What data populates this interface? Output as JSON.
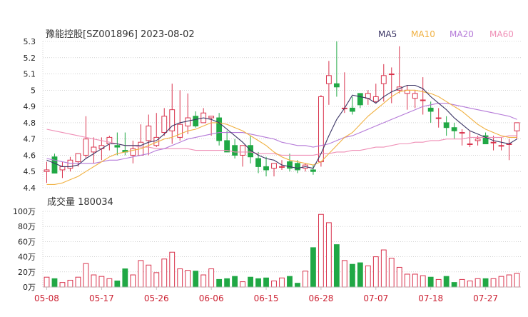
{
  "header": {
    "title": "豫能控股[SZ001896] 2023-08-02",
    "ma5_label": "MA5",
    "ma10_label": "MA10",
    "ma20_label": "MA20",
    "ma60_label": "MA60"
  },
  "colors": {
    "up": "#d9334d",
    "down": "#20a845",
    "ma5": "#3b3565",
    "ma10": "#f0b040",
    "ma20": "#b57ad8",
    "ma60": "#ef8fb6",
    "grid": "#b9b9b9",
    "axis_text": "#222222",
    "date_text": "#cc2233"
  },
  "volume_panel": {
    "title": "成交量 180034"
  },
  "chart_data": [
    {
      "type": "candlestick",
      "title": "豫能控股[SZ001896] 2023-08-02",
      "ylim": [
        4.4,
        5.3
      ],
      "yticks": [
        "5.3",
        "5.2",
        "5.1",
        "5",
        "4.9",
        "4.8",
        "4.7",
        "4.6",
        "4.5",
        "4.4"
      ],
      "x": [
        "05-08",
        "05-09",
        "05-10",
        "05-11",
        "05-12",
        "05-15",
        "05-16",
        "05-17",
        "05-18",
        "05-19",
        "05-22",
        "05-23",
        "05-24",
        "05-25",
        "05-26",
        "05-29",
        "05-30",
        "05-31",
        "06-01",
        "06-02",
        "06-05",
        "06-06",
        "06-07",
        "06-08",
        "06-09",
        "06-12",
        "06-13",
        "06-14",
        "06-15",
        "06-16",
        "06-19",
        "06-20",
        "06-21",
        "06-26",
        "06-27",
        "06-28",
        "06-29",
        "06-30",
        "07-03",
        "07-04",
        "07-05",
        "07-06",
        "07-07",
        "07-10",
        "07-11",
        "07-12",
        "07-13",
        "07-14",
        "07-17",
        "07-18",
        "07-19",
        "07-20",
        "07-21",
        "07-24",
        "07-25",
        "07-26",
        "07-27",
        "07-28",
        "07-31",
        "08-01",
        "08-02"
      ],
      "x_tick_labels": [
        "05-08",
        "05-17",
        "05-26",
        "06-06",
        "06-15",
        "06-28",
        "07-07",
        "07-18",
        "07-27"
      ],
      "open": [
        4.5,
        4.59,
        4.51,
        4.52,
        4.56,
        4.6,
        4.62,
        4.64,
        4.67,
        4.66,
        4.63,
        4.6,
        4.6,
        4.69,
        4.66,
        4.74,
        4.75,
        4.71,
        4.78,
        4.84,
        4.8,
        4.83,
        4.83,
        4.69,
        4.66,
        4.6,
        4.66,
        4.58,
        4.53,
        4.52,
        4.53,
        4.56,
        4.55,
        4.52,
        4.51,
        4.56,
        5.04,
        5.04,
        4.89,
        4.89,
        4.98,
        4.95,
        4.93,
        5.04,
        5.1,
        5.0,
        4.98,
        4.95,
        4.94,
        4.89,
        4.83,
        4.8,
        4.77,
        4.74,
        4.67,
        4.69,
        4.72,
        4.68,
        4.66,
        4.67,
        4.75
      ],
      "high": [
        4.56,
        4.61,
        4.56,
        4.59,
        4.61,
        4.84,
        4.71,
        4.71,
        4.72,
        4.74,
        4.74,
        4.69,
        4.79,
        4.85,
        4.86,
        4.89,
        5.04,
        5.0,
        4.98,
        4.87,
        4.89,
        4.84,
        4.86,
        4.75,
        4.7,
        4.66,
        4.72,
        4.62,
        4.59,
        4.55,
        4.57,
        4.61,
        4.57,
        4.55,
        4.54,
        4.97,
        5.18,
        5.3,
        5.11,
        4.96,
        4.97,
        5.0,
        5.04,
        5.16,
        5.14,
        5.27,
        5.03,
        5.0,
        5.08,
        4.93,
        4.89,
        4.84,
        4.8,
        4.76,
        4.75,
        4.72,
        4.74,
        4.72,
        4.71,
        4.7,
        4.8
      ],
      "low": [
        4.43,
        4.51,
        4.46,
        4.5,
        4.53,
        4.58,
        4.55,
        4.57,
        4.63,
        4.6,
        4.6,
        4.55,
        4.6,
        4.6,
        4.65,
        4.72,
        4.67,
        4.69,
        4.73,
        4.77,
        4.8,
        4.72,
        4.66,
        4.62,
        4.58,
        4.53,
        4.55,
        4.49,
        4.47,
        4.47,
        4.51,
        4.5,
        4.49,
        4.5,
        4.48,
        4.53,
        4.91,
        4.96,
        4.86,
        4.85,
        4.89,
        4.91,
        4.92,
        4.93,
        4.92,
        4.98,
        4.88,
        4.89,
        4.85,
        4.8,
        4.77,
        4.72,
        4.7,
        4.66,
        4.65,
        4.66,
        4.67,
        4.63,
        4.63,
        4.57,
        4.7
      ],
      "close": [
        4.51,
        4.49,
        4.53,
        4.57,
        4.61,
        4.7,
        4.65,
        4.66,
        4.71,
        4.65,
        4.62,
        4.64,
        4.68,
        4.78,
        4.71,
        4.84,
        4.88,
        4.79,
        4.83,
        4.78,
        4.86,
        4.84,
        4.69,
        4.62,
        4.6,
        4.66,
        4.59,
        4.53,
        4.51,
        4.55,
        4.53,
        4.52,
        4.51,
        4.54,
        4.5,
        4.96,
        5.09,
        5.02,
        4.89,
        4.87,
        4.91,
        4.98,
        4.96,
        5.09,
        5.1,
        5.02,
        5.0,
        4.98,
        4.94,
        4.87,
        4.83,
        4.77,
        4.75,
        4.74,
        4.67,
        4.7,
        4.67,
        4.68,
        4.66,
        4.67,
        4.8
      ],
      "ma5": [
        4.57,
        4.55,
        4.53,
        4.53,
        4.54,
        4.58,
        4.61,
        4.64,
        4.67,
        4.67,
        4.66,
        4.66,
        4.66,
        4.68,
        4.69,
        4.73,
        4.78,
        4.8,
        4.81,
        4.82,
        4.83,
        4.82,
        4.8,
        4.76,
        4.72,
        4.68,
        4.63,
        4.6,
        4.58,
        4.57,
        4.54,
        4.53,
        4.52,
        4.53,
        4.52,
        4.61,
        4.72,
        4.82,
        4.89,
        4.97,
        4.96,
        4.95,
        4.92,
        4.96,
        4.99,
        5.01,
        5.03,
        5.03,
        5.01,
        4.96,
        4.92,
        4.88,
        4.83,
        4.79,
        4.75,
        4.73,
        4.71,
        4.69,
        4.68,
        4.67,
        4.7
      ],
      "ma10": [
        4.42,
        4.42,
        4.43,
        4.45,
        4.47,
        4.5,
        4.53,
        4.56,
        4.59,
        4.61,
        4.62,
        4.63,
        4.64,
        4.66,
        4.68,
        4.7,
        4.71,
        4.73,
        4.75,
        4.76,
        4.78,
        4.8,
        4.8,
        4.79,
        4.77,
        4.75,
        4.72,
        4.69,
        4.66,
        4.62,
        4.59,
        4.57,
        4.56,
        4.55,
        4.54,
        4.56,
        4.61,
        4.66,
        4.71,
        4.74,
        4.79,
        4.84,
        4.88,
        4.92,
        4.96,
        4.99,
        5.0,
        5.0,
        4.99,
        4.98,
        4.96,
        4.93,
        4.9,
        4.87,
        4.83,
        4.79,
        4.76,
        4.74,
        4.72,
        4.71,
        4.71
      ],
      "ma20": [
        4.58,
        4.57,
        4.56,
        4.55,
        4.55,
        4.55,
        4.55,
        4.56,
        4.57,
        4.57,
        4.58,
        4.59,
        4.6,
        4.61,
        4.63,
        4.64,
        4.66,
        4.68,
        4.7,
        4.71,
        4.72,
        4.73,
        4.74,
        4.74,
        4.74,
        4.74,
        4.73,
        4.72,
        4.71,
        4.7,
        4.68,
        4.67,
        4.66,
        4.66,
        4.65,
        4.66,
        4.67,
        4.69,
        4.71,
        4.72,
        4.74,
        4.76,
        4.78,
        4.8,
        4.82,
        4.84,
        4.86,
        4.88,
        4.9,
        4.91,
        4.92,
        4.92,
        4.91,
        4.9,
        4.89,
        4.88,
        4.87,
        4.86,
        4.85,
        4.84,
        4.82
      ],
      "ma60": [
        4.76,
        4.75,
        4.74,
        4.73,
        4.72,
        4.71,
        4.7,
        4.69,
        4.68,
        4.67,
        4.66,
        4.66,
        4.65,
        4.65,
        4.64,
        4.64,
        4.64,
        4.64,
        4.64,
        4.63,
        4.63,
        4.63,
        4.63,
        4.63,
        4.62,
        4.62,
        4.62,
        4.61,
        4.61,
        4.61,
        4.6,
        4.6,
        4.6,
        4.6,
        4.6,
        4.61,
        4.61,
        4.62,
        4.62,
        4.63,
        4.63,
        4.64,
        4.65,
        4.65,
        4.66,
        4.67,
        4.67,
        4.68,
        4.68,
        4.69,
        4.69,
        4.7,
        4.7,
        4.7,
        4.71,
        4.71,
        4.71,
        4.71,
        4.71,
        4.72,
        4.72
      ]
    },
    {
      "type": "bar",
      "title": "成交量 180034",
      "ylim": [
        0,
        100
      ],
      "yticks": [
        "100万",
        "80万",
        "60万",
        "40万",
        "20万",
        "0万"
      ],
      "volume_wan": [
        13,
        11,
        6,
        9,
        13,
        31,
        16,
        14,
        11,
        8,
        24,
        16,
        35,
        29,
        19,
        37,
        46,
        24,
        22,
        21,
        16,
        24,
        10,
        11,
        14,
        7,
        13,
        11,
        12,
        8,
        12,
        14,
        5,
        21,
        52,
        96,
        85,
        56,
        35,
        30,
        32,
        28,
        40,
        49,
        38,
        26,
        17,
        17,
        15,
        13,
        10,
        14,
        6,
        10,
        8,
        11,
        11,
        11,
        14,
        16,
        18
      ]
    }
  ]
}
